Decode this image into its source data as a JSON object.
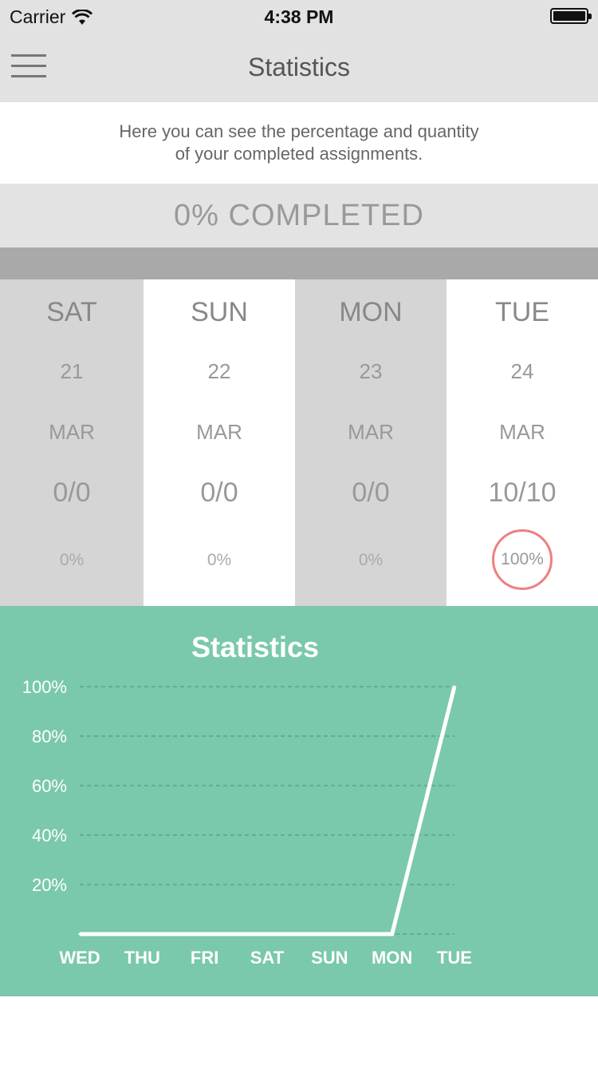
{
  "status_bar": {
    "carrier": "Carrier",
    "time": "4:38 PM",
    "wifi_icon": "wifi-icon",
    "battery_icon": "battery-icon"
  },
  "nav": {
    "menu_icon": "hamburger-menu-icon",
    "title": "Statistics"
  },
  "intro": {
    "line1": "Here you can see the percentage and quantity",
    "line2": "of your completed assignments."
  },
  "summary": {
    "completed_label": "0% COMPLETED"
  },
  "days": [
    {
      "day": "SAT",
      "date": "21",
      "month": "MAR",
      "quantity": "0/0",
      "percent": "0%",
      "highlighted": false
    },
    {
      "day": "SUN",
      "date": "22",
      "month": "MAR",
      "quantity": "0/0",
      "percent": "0%",
      "highlighted": false
    },
    {
      "day": "MON",
      "date": "23",
      "month": "MAR",
      "quantity": "0/0",
      "percent": "0%",
      "highlighted": false
    },
    {
      "day": "TUE",
      "date": "24",
      "month": "MAR",
      "quantity": "10/10",
      "percent": "100%",
      "highlighted": true
    }
  ],
  "colors": {
    "chart_background": "#7ac9aa",
    "highlight_circle": "#ef7f7f",
    "shaded_column": "#d5d5d5",
    "divider": "#a9a9a9"
  },
  "chart_data": {
    "type": "line",
    "title": "Statistics",
    "categories": [
      "WED",
      "THU",
      "FRI",
      "SAT",
      "SUN",
      "MON",
      "TUE"
    ],
    "series": [
      {
        "values": [
          0,
          0,
          0,
          0,
          0,
          0,
          100
        ]
      }
    ],
    "yticks": [
      "100%",
      "80%",
      "60%",
      "40%",
      "20%"
    ],
    "ylim": [
      0,
      100
    ],
    "grid": true,
    "grid_style": "dashed"
  }
}
